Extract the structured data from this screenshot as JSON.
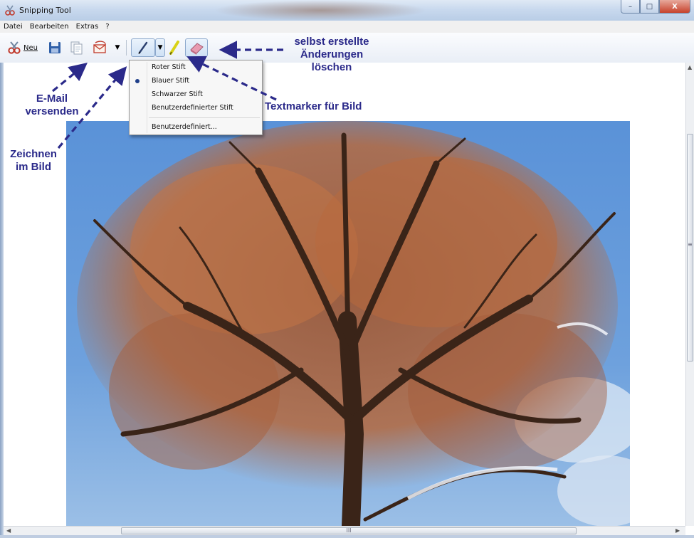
{
  "window": {
    "title": "Snipping Tool",
    "controls": {
      "minimize": "–",
      "maximize": "□",
      "close": "X"
    }
  },
  "menubar": {
    "items": [
      "Datei",
      "Bearbeiten",
      "Extras",
      "?"
    ]
  },
  "toolbar": {
    "new_label": "Neu",
    "icons": [
      "scissors-icon",
      "save-icon",
      "copy-icon",
      "send-email-icon",
      "dropdown-arrow",
      "pen-icon",
      "dropdown-arrow",
      "highlighter-icon",
      "eraser-icon"
    ]
  },
  "pen_menu": {
    "items": [
      "Roter Stift",
      "Blauer Stift",
      "Schwarzer Stift",
      "Benutzerdefinierter Stift"
    ],
    "custom": "Benutzerdefiniert...",
    "selected": "Blauer Stift"
  },
  "annotations": {
    "email_line1": "E-Mail",
    "email_line2": "versenden",
    "draw_line1": "Zeichnen",
    "draw_line2": "im Bild",
    "erase_line1": "selbst erstellte",
    "erase_line2": "Änderungen",
    "erase_line3": "löschen",
    "highlighter": "Textmarker für Bild",
    "color": "#2b2a8a"
  },
  "scrollbar": {
    "h_grip": "III",
    "v_grip": "≡"
  },
  "colors": {
    "sky": "#4d87d1",
    "foliage": "#b5693e",
    "branch": "#3a2418"
  }
}
